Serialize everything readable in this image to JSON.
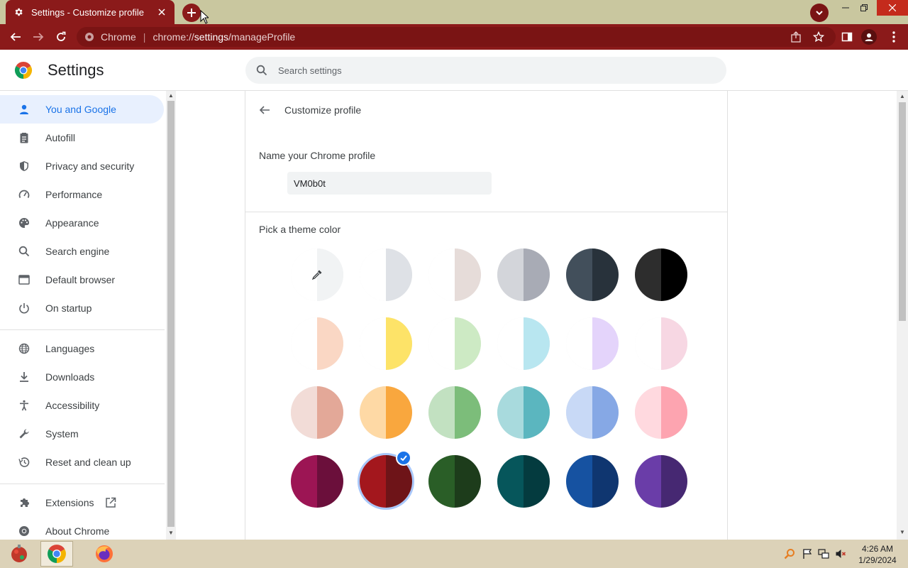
{
  "browser": {
    "tab_title": "Settings - Customize profile",
    "omnibox_chip": "Chrome",
    "url_prefix": "chrome://",
    "url_host": "settings",
    "url_path": "/manageProfile",
    "accent_color": "#8b1a1a"
  },
  "header": {
    "title": "Settings",
    "search_placeholder": "Search settings"
  },
  "sidebar": {
    "items": [
      {
        "label": "You and Google",
        "icon": "person-icon",
        "active": true
      },
      {
        "label": "Autofill",
        "icon": "clipboard-icon"
      },
      {
        "label": "Privacy and security",
        "icon": "shield-icon"
      },
      {
        "label": "Performance",
        "icon": "gauge-icon"
      },
      {
        "label": "Appearance",
        "icon": "palette-icon"
      },
      {
        "label": "Search engine",
        "icon": "search-icon"
      },
      {
        "label": "Default browser",
        "icon": "browser-window-icon"
      },
      {
        "label": "On startup",
        "icon": "power-icon"
      },
      {
        "label": "Languages",
        "icon": "globe-icon"
      },
      {
        "label": "Downloads",
        "icon": "download-icon"
      },
      {
        "label": "Accessibility",
        "icon": "accessibility-icon"
      },
      {
        "label": "System",
        "icon": "wrench-icon"
      },
      {
        "label": "Reset and clean up",
        "icon": "restore-icon"
      },
      {
        "label": "Extensions",
        "icon": "puzzle-icon"
      },
      {
        "label": "About Chrome",
        "icon": "chrome-icon"
      }
    ]
  },
  "main": {
    "subpage_title": "Customize profile",
    "name_label": "Name your Chrome profile",
    "profile_name": "VM0b0t",
    "theme_label": "Pick a theme color",
    "theme_colors": [
      [
        {
          "left": "#ffffff",
          "right": "#f1f3f4",
          "custom": true
        },
        {
          "left": "#ffffff",
          "right": "#dee1e6"
        },
        {
          "left": "#ffffff",
          "right": "#e6dcd9"
        },
        {
          "left": "#d3d5da",
          "right": "#a8abb5"
        },
        {
          "left": "#424f5b",
          "right": "#28323b"
        },
        {
          "left": "#2d2d2d",
          "right": "#000000"
        }
      ],
      [
        {
          "left": "#ffffff",
          "right": "#fad7c4"
        },
        {
          "left": "#ffffff",
          "right": "#fde368"
        },
        {
          "left": "#ffffff",
          "right": "#cdeac4"
        },
        {
          "left": "#ffffff",
          "right": "#b8e6f0"
        },
        {
          "left": "#ffffff",
          "right": "#e4d4fb"
        },
        {
          "left": "#ffffff",
          "right": "#f7d7e3"
        }
      ],
      [
        {
          "left": "#f2dcd7",
          "right": "#e3a898"
        },
        {
          "left": "#fed9a5",
          "right": "#f9a73e"
        },
        {
          "left": "#c2e1c1",
          "right": "#7cbd7a"
        },
        {
          "left": "#a8dadd",
          "right": "#5bb6bf"
        },
        {
          "left": "#c8d9f6",
          "right": "#86a8e5"
        },
        {
          "left": "#ffd9df",
          "right": "#fda4b0"
        }
      ],
      [
        {
          "left": "#9c1554",
          "right": "#6b0f3b"
        },
        {
          "left": "#a3171d",
          "right": "#6e1418",
          "selected": true
        },
        {
          "left": "#2a5e27",
          "right": "#1d3c1b"
        },
        {
          "left": "#06565b",
          "right": "#043b3f"
        },
        {
          "left": "#1652a1",
          "right": "#0f3670"
        },
        {
          "left": "#6a3da8",
          "right": "#462872"
        }
      ]
    ]
  },
  "taskbar": {
    "time": "4:26 AM",
    "date": "1/29/2024"
  }
}
